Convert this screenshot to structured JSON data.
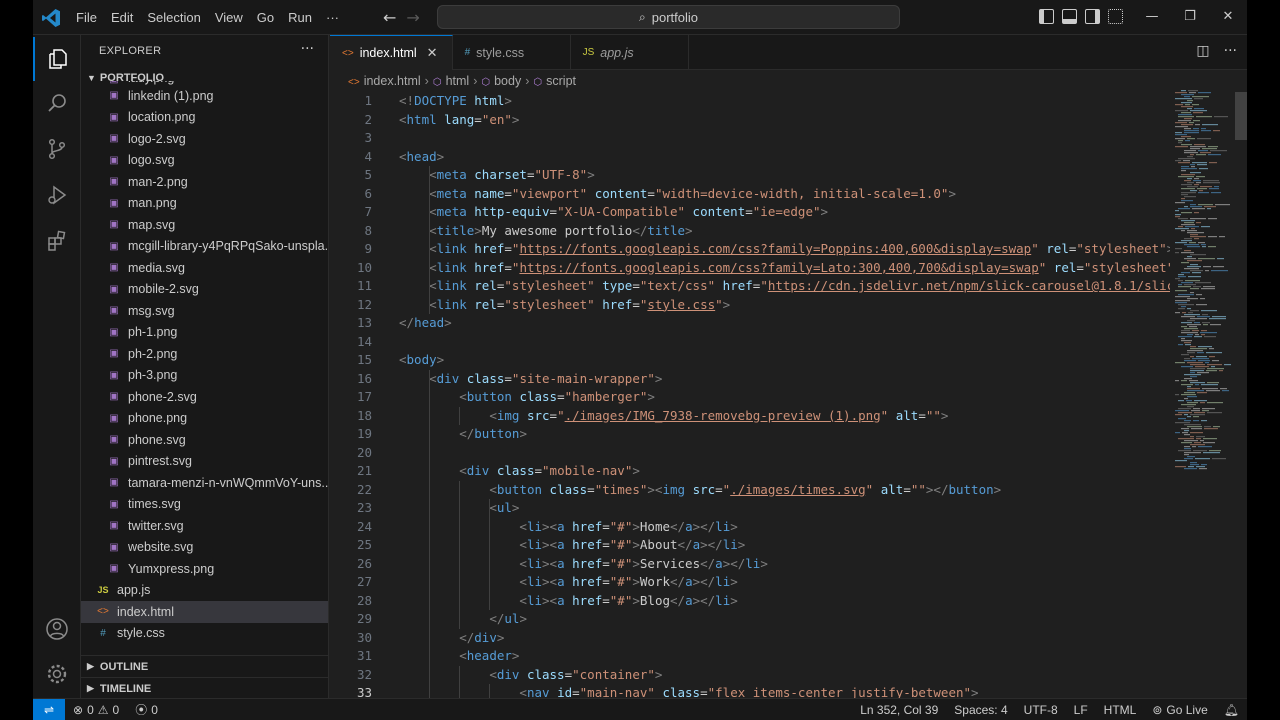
{
  "titlebar": {
    "menus": [
      "File",
      "Edit",
      "Selection",
      "View",
      "Go",
      "Run",
      "···"
    ],
    "search_text": "portfolio"
  },
  "sidebar": {
    "title": "EXPLORER",
    "folder": "PORTFOLIO",
    "partial_top": "lady.png",
    "files": [
      {
        "name": "linkedin (1).png",
        "type": "img"
      },
      {
        "name": "location.png",
        "type": "img"
      },
      {
        "name": "logo-2.svg",
        "type": "img"
      },
      {
        "name": "logo.svg",
        "type": "img"
      },
      {
        "name": "man-2.png",
        "type": "img"
      },
      {
        "name": "man.png",
        "type": "img"
      },
      {
        "name": "map.svg",
        "type": "img"
      },
      {
        "name": "mcgill-library-y4PqRPqSako-unspla...",
        "type": "img"
      },
      {
        "name": "media.svg",
        "type": "img"
      },
      {
        "name": "mobile-2.svg",
        "type": "img"
      },
      {
        "name": "msg.svg",
        "type": "img"
      },
      {
        "name": "ph-1.png",
        "type": "img"
      },
      {
        "name": "ph-2.png",
        "type": "img"
      },
      {
        "name": "ph-3.png",
        "type": "img"
      },
      {
        "name": "phone-2.svg",
        "type": "img"
      },
      {
        "name": "phone.png",
        "type": "img"
      },
      {
        "name": "phone.svg",
        "type": "img"
      },
      {
        "name": "pintrest.svg",
        "type": "img"
      },
      {
        "name": "tamara-menzi-n-vnWQmmVoY-uns...",
        "type": "img"
      },
      {
        "name": "times.svg",
        "type": "img"
      },
      {
        "name": "twitter.svg",
        "type": "img"
      },
      {
        "name": "website.svg",
        "type": "img"
      },
      {
        "name": "Yumxpress.png",
        "type": "img"
      }
    ],
    "root_files": [
      {
        "name": "app.js",
        "type": "js",
        "selected": false
      },
      {
        "name": "index.html",
        "type": "html",
        "selected": true
      },
      {
        "name": "style.css",
        "type": "css",
        "selected": false
      }
    ],
    "outline_label": "OUTLINE",
    "timeline_label": "TIMELINE"
  },
  "tabs": [
    {
      "label": "index.html",
      "type": "html",
      "active": true
    },
    {
      "label": "style.css",
      "type": "css",
      "active": false
    },
    {
      "label": "app.js",
      "type": "js",
      "active": false
    }
  ],
  "breadcrumb": [
    "index.html",
    "html",
    "body",
    "script"
  ],
  "code_lines": [
    [
      [
        "pu",
        "<!"
      ],
      [
        "tg",
        "DOCTYPE"
      ],
      [
        "tx",
        " "
      ],
      [
        "at",
        "html"
      ],
      [
        "pu",
        ">"
      ]
    ],
    [
      [
        "pu",
        "<"
      ],
      [
        "tg",
        "html"
      ],
      [
        "tx",
        " "
      ],
      [
        "at",
        "lang"
      ],
      [
        "tx",
        "="
      ],
      [
        "st",
        "\"en\""
      ],
      [
        "pu",
        ">"
      ]
    ],
    [],
    [
      [
        "pu",
        "<"
      ],
      [
        "tg",
        "head"
      ],
      [
        "pu",
        ">"
      ]
    ],
    [
      [
        "tx",
        "    "
      ],
      [
        "pu",
        "<"
      ],
      [
        "tg",
        "meta"
      ],
      [
        "tx",
        " "
      ],
      [
        "at",
        "charset"
      ],
      [
        "tx",
        "="
      ],
      [
        "st",
        "\"UTF-8\""
      ],
      [
        "pu",
        ">"
      ]
    ],
    [
      [
        "tx",
        "    "
      ],
      [
        "pu",
        "<"
      ],
      [
        "tg",
        "meta"
      ],
      [
        "tx",
        " "
      ],
      [
        "at",
        "name"
      ],
      [
        "tx",
        "="
      ],
      [
        "st",
        "\"viewport\""
      ],
      [
        "tx",
        " "
      ],
      [
        "at",
        "content"
      ],
      [
        "tx",
        "="
      ],
      [
        "st",
        "\"width=device-width, initial-scale=1.0\""
      ],
      [
        "pu",
        ">"
      ]
    ],
    [
      [
        "tx",
        "    "
      ],
      [
        "pu",
        "<"
      ],
      [
        "tg",
        "meta"
      ],
      [
        "tx",
        " "
      ],
      [
        "at",
        "http-equiv"
      ],
      [
        "tx",
        "="
      ],
      [
        "st",
        "\"X-UA-Compatible\""
      ],
      [
        "tx",
        " "
      ],
      [
        "at",
        "content"
      ],
      [
        "tx",
        "="
      ],
      [
        "st",
        "\"ie=edge\""
      ],
      [
        "pu",
        ">"
      ]
    ],
    [
      [
        "tx",
        "    "
      ],
      [
        "pu",
        "<"
      ],
      [
        "tg",
        "title"
      ],
      [
        "pu",
        ">"
      ],
      [
        "tx",
        "My awesome portfolio"
      ],
      [
        "pu",
        "</"
      ],
      [
        "tg",
        "title"
      ],
      [
        "pu",
        ">"
      ]
    ],
    [
      [
        "tx",
        "    "
      ],
      [
        "pu",
        "<"
      ],
      [
        "tg",
        "link"
      ],
      [
        "tx",
        " "
      ],
      [
        "at",
        "href"
      ],
      [
        "tx",
        "="
      ],
      [
        "st",
        "\""
      ],
      [
        "stu",
        "https://fonts.googleapis.com/css?family=Poppins:400,600&display=swap"
      ],
      [
        "st",
        "\""
      ],
      [
        "tx",
        " "
      ],
      [
        "at",
        "rel"
      ],
      [
        "tx",
        "="
      ],
      [
        "st",
        "\"stylesheet\""
      ],
      [
        "pu",
        ">"
      ]
    ],
    [
      [
        "tx",
        "    "
      ],
      [
        "pu",
        "<"
      ],
      [
        "tg",
        "link"
      ],
      [
        "tx",
        " "
      ],
      [
        "at",
        "href"
      ],
      [
        "tx",
        "="
      ],
      [
        "st",
        "\""
      ],
      [
        "stu",
        "https://fonts.googleapis.com/css?family=Lato:300,400,700&display=swap"
      ],
      [
        "st",
        "\""
      ],
      [
        "tx",
        " "
      ],
      [
        "at",
        "rel"
      ],
      [
        "tx",
        "="
      ],
      [
        "st",
        "\"stylesheet\""
      ]
    ],
    [
      [
        "tx",
        "    "
      ],
      [
        "pu",
        "<"
      ],
      [
        "tg",
        "link"
      ],
      [
        "tx",
        " "
      ],
      [
        "at",
        "rel"
      ],
      [
        "tx",
        "="
      ],
      [
        "st",
        "\"stylesheet\""
      ],
      [
        "tx",
        " "
      ],
      [
        "at",
        "type"
      ],
      [
        "tx",
        "="
      ],
      [
        "st",
        "\"text/css\""
      ],
      [
        "tx",
        " "
      ],
      [
        "at",
        "href"
      ],
      [
        "tx",
        "="
      ],
      [
        "st",
        "\""
      ],
      [
        "stu",
        "https://cdn.jsdelivr.net/npm/slick-carousel@1.8.1/slic"
      ]
    ],
    [
      [
        "tx",
        "    "
      ],
      [
        "pu",
        "<"
      ],
      [
        "tg",
        "link"
      ],
      [
        "tx",
        " "
      ],
      [
        "at",
        "rel"
      ],
      [
        "tx",
        "="
      ],
      [
        "st",
        "\"stylesheet\""
      ],
      [
        "tx",
        " "
      ],
      [
        "at",
        "href"
      ],
      [
        "tx",
        "="
      ],
      [
        "st",
        "\""
      ],
      [
        "stu",
        "style.css"
      ],
      [
        "st",
        "\""
      ],
      [
        "pu",
        ">"
      ]
    ],
    [
      [
        "pu",
        "</"
      ],
      [
        "tg",
        "head"
      ],
      [
        "pu",
        ">"
      ]
    ],
    [],
    [
      [
        "pu",
        "<"
      ],
      [
        "tg",
        "body"
      ],
      [
        "pu",
        ">"
      ]
    ],
    [
      [
        "tx",
        "    "
      ],
      [
        "pu",
        "<"
      ],
      [
        "tg",
        "div"
      ],
      [
        "tx",
        " "
      ],
      [
        "at",
        "class"
      ],
      [
        "tx",
        "="
      ],
      [
        "st",
        "\"site-main-wrapper\""
      ],
      [
        "pu",
        ">"
      ]
    ],
    [
      [
        "tx",
        "        "
      ],
      [
        "pu",
        "<"
      ],
      [
        "tg",
        "button"
      ],
      [
        "tx",
        " "
      ],
      [
        "at",
        "class"
      ],
      [
        "tx",
        "="
      ],
      [
        "st",
        "\"hamberger\""
      ],
      [
        "pu",
        ">"
      ]
    ],
    [
      [
        "tx",
        "            "
      ],
      [
        "pu",
        "<"
      ],
      [
        "tg",
        "img"
      ],
      [
        "tx",
        " "
      ],
      [
        "at",
        "src"
      ],
      [
        "tx",
        "="
      ],
      [
        "st",
        "\""
      ],
      [
        "stu",
        "./images/IMG_7938-removebg-preview (1).png"
      ],
      [
        "st",
        "\""
      ],
      [
        "tx",
        " "
      ],
      [
        "at",
        "alt"
      ],
      [
        "tx",
        "="
      ],
      [
        "st",
        "\"\""
      ],
      [
        "pu",
        ">"
      ]
    ],
    [
      [
        "tx",
        "        "
      ],
      [
        "pu",
        "</"
      ],
      [
        "tg",
        "button"
      ],
      [
        "pu",
        ">"
      ]
    ],
    [],
    [
      [
        "tx",
        "        "
      ],
      [
        "pu",
        "<"
      ],
      [
        "tg",
        "div"
      ],
      [
        "tx",
        " "
      ],
      [
        "at",
        "class"
      ],
      [
        "tx",
        "="
      ],
      [
        "st",
        "\"mobile-nav\""
      ],
      [
        "pu",
        ">"
      ]
    ],
    [
      [
        "tx",
        "            "
      ],
      [
        "pu",
        "<"
      ],
      [
        "tg",
        "button"
      ],
      [
        "tx",
        " "
      ],
      [
        "at",
        "class"
      ],
      [
        "tx",
        "="
      ],
      [
        "st",
        "\"times\""
      ],
      [
        "pu",
        "><"
      ],
      [
        "tg",
        "img"
      ],
      [
        "tx",
        " "
      ],
      [
        "at",
        "src"
      ],
      [
        "tx",
        "="
      ],
      [
        "st",
        "\""
      ],
      [
        "stu",
        "./images/times.svg"
      ],
      [
        "st",
        "\""
      ],
      [
        "tx",
        " "
      ],
      [
        "at",
        "alt"
      ],
      [
        "tx",
        "="
      ],
      [
        "st",
        "\"\""
      ],
      [
        "pu",
        "></"
      ],
      [
        "tg",
        "button"
      ],
      [
        "pu",
        ">"
      ]
    ],
    [
      [
        "tx",
        "            "
      ],
      [
        "pu",
        "<"
      ],
      [
        "tg",
        "ul"
      ],
      [
        "pu",
        ">"
      ]
    ],
    [
      [
        "tx",
        "                "
      ],
      [
        "pu",
        "<"
      ],
      [
        "tg",
        "li"
      ],
      [
        "pu",
        "><"
      ],
      [
        "tg",
        "a"
      ],
      [
        "tx",
        " "
      ],
      [
        "at",
        "href"
      ],
      [
        "tx",
        "="
      ],
      [
        "st",
        "\"#\""
      ],
      [
        "pu",
        ">"
      ],
      [
        "tx",
        "Home"
      ],
      [
        "pu",
        "</"
      ],
      [
        "tg",
        "a"
      ],
      [
        "pu",
        "></"
      ],
      [
        "tg",
        "li"
      ],
      [
        "pu",
        ">"
      ]
    ],
    [
      [
        "tx",
        "                "
      ],
      [
        "pu",
        "<"
      ],
      [
        "tg",
        "li"
      ],
      [
        "pu",
        "><"
      ],
      [
        "tg",
        "a"
      ],
      [
        "tx",
        " "
      ],
      [
        "at",
        "href"
      ],
      [
        "tx",
        "="
      ],
      [
        "st",
        "\"#\""
      ],
      [
        "pu",
        ">"
      ],
      [
        "tx",
        "About"
      ],
      [
        "pu",
        "</"
      ],
      [
        "tg",
        "a"
      ],
      [
        "pu",
        "></"
      ],
      [
        "tg",
        "li"
      ],
      [
        "pu",
        ">"
      ]
    ],
    [
      [
        "tx",
        "                "
      ],
      [
        "pu",
        "<"
      ],
      [
        "tg",
        "li"
      ],
      [
        "pu",
        "><"
      ],
      [
        "tg",
        "a"
      ],
      [
        "tx",
        " "
      ],
      [
        "at",
        "href"
      ],
      [
        "tx",
        "="
      ],
      [
        "st",
        "\"#\""
      ],
      [
        "pu",
        ">"
      ],
      [
        "tx",
        "Services"
      ],
      [
        "pu",
        "</"
      ],
      [
        "tg",
        "a"
      ],
      [
        "pu",
        "></"
      ],
      [
        "tg",
        "li"
      ],
      [
        "pu",
        ">"
      ]
    ],
    [
      [
        "tx",
        "                "
      ],
      [
        "pu",
        "<"
      ],
      [
        "tg",
        "li"
      ],
      [
        "pu",
        "><"
      ],
      [
        "tg",
        "a"
      ],
      [
        "tx",
        " "
      ],
      [
        "at",
        "href"
      ],
      [
        "tx",
        "="
      ],
      [
        "st",
        "\"#\""
      ],
      [
        "pu",
        ">"
      ],
      [
        "tx",
        "Work"
      ],
      [
        "pu",
        "</"
      ],
      [
        "tg",
        "a"
      ],
      [
        "pu",
        "></"
      ],
      [
        "tg",
        "li"
      ],
      [
        "pu",
        ">"
      ]
    ],
    [
      [
        "tx",
        "                "
      ],
      [
        "pu",
        "<"
      ],
      [
        "tg",
        "li"
      ],
      [
        "pu",
        "><"
      ],
      [
        "tg",
        "a"
      ],
      [
        "tx",
        " "
      ],
      [
        "at",
        "href"
      ],
      [
        "tx",
        "="
      ],
      [
        "st",
        "\"#\""
      ],
      [
        "pu",
        ">"
      ],
      [
        "tx",
        "Blog"
      ],
      [
        "pu",
        "</"
      ],
      [
        "tg",
        "a"
      ],
      [
        "pu",
        "></"
      ],
      [
        "tg",
        "li"
      ],
      [
        "pu",
        ">"
      ]
    ],
    [
      [
        "tx",
        "            "
      ],
      [
        "pu",
        "</"
      ],
      [
        "tg",
        "ul"
      ],
      [
        "pu",
        ">"
      ]
    ],
    [
      [
        "tx",
        "        "
      ],
      [
        "pu",
        "</"
      ],
      [
        "tg",
        "div"
      ],
      [
        "pu",
        ">"
      ]
    ],
    [
      [
        "tx",
        "        "
      ],
      [
        "pu",
        "<"
      ],
      [
        "tg",
        "header"
      ],
      [
        "pu",
        ">"
      ]
    ],
    [
      [
        "tx",
        "            "
      ],
      [
        "pu",
        "<"
      ],
      [
        "tg",
        "div"
      ],
      [
        "tx",
        " "
      ],
      [
        "at",
        "class"
      ],
      [
        "tx",
        "="
      ],
      [
        "st",
        "\"container\""
      ],
      [
        "pu",
        ">"
      ]
    ],
    [
      [
        "tx",
        "                "
      ],
      [
        "pu",
        "<"
      ],
      [
        "tg",
        "nav"
      ],
      [
        "tx",
        " "
      ],
      [
        "at",
        "id"
      ],
      [
        "tx",
        "="
      ],
      [
        "st",
        "\"main-nav\""
      ],
      [
        "tx",
        " "
      ],
      [
        "at",
        "class"
      ],
      [
        "tx",
        "="
      ],
      [
        "st",
        "\"flex items-center justify-between\""
      ],
      [
        "pu",
        ">"
      ]
    ]
  ],
  "statusbar": {
    "errors": "0",
    "warnings": "0",
    "ports": "0",
    "position": "Ln 352, Col 39",
    "spaces": "Spaces: 4",
    "encoding": "UTF-8",
    "eol": "LF",
    "language": "HTML",
    "golive": "Go Live"
  },
  "colors": {
    "accent": "#0078d4",
    "tag": "#569cd6",
    "attr": "#9cdcfe",
    "string": "#ce9178"
  }
}
